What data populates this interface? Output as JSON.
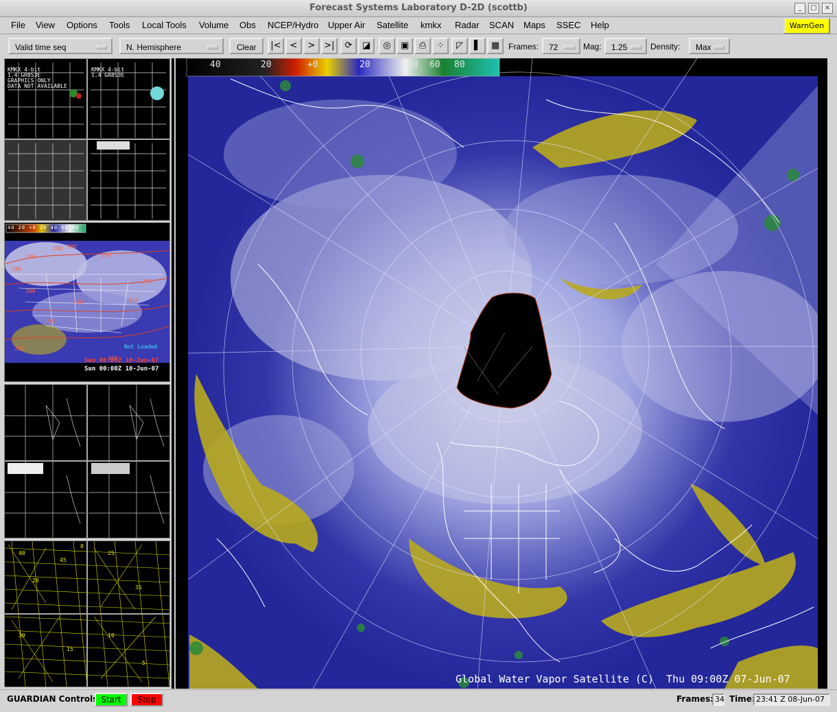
{
  "window": {
    "title": "Forecast Systems Laboratory D-2D (scottb)",
    "buttons": [
      "_",
      "□",
      "×"
    ]
  },
  "menu": {
    "items": [
      "File",
      "View",
      "Options",
      "Tools",
      "Local Tools",
      "Volume",
      "Obs",
      "NCEP/Hydro",
      "Upper Air",
      "Satellite",
      "kmkx",
      "Radar",
      "SCAN",
      "Maps",
      "SSEC",
      "Help"
    ],
    "warngen": "WarnGen"
  },
  "toolbar": {
    "time_mode": "Valid time seq",
    "projection": "N. Hemisphere",
    "clear": "Clear",
    "frames_label": "Frames:",
    "frames_value": "72",
    "mag_label": "Mag:",
    "mag_value": "1.25",
    "density_label": "Density:",
    "density_value": "Max"
  },
  "colorbar": {
    "labels": [
      "40",
      "20",
      "+0",
      "20",
      "40",
      "60",
      "80"
    ]
  },
  "left_panel": {
    "pane1": {
      "lines": [
        "KMKX 4-bit",
        "1.4 GR8S3E",
        "GRAPHICS ONLY",
        "DATA NOT AVAILABLE"
      ],
      "sub": [
        "KMKX 4-bit",
        "1.4 GR8S3E"
      ]
    },
    "pane2": {
      "scale": [
        "40",
        "20",
        "+0",
        "20",
        "40",
        "60",
        "80"
      ],
      "valid1": "Sun 00:00Z 10-Jun-07",
      "valid2": "Sun 00:00Z 10-Jun-07",
      "note": "Not Loaded",
      "contours": [
        "300",
        "290",
        "280",
        "270",
        "280",
        "290",
        "300",
        "290",
        "280",
        "270",
        "290",
        "300"
      ]
    },
    "pane4": {
      "nums": [
        "40",
        "45",
        "20",
        "25",
        "35",
        "30",
        "15",
        "10",
        "5",
        "0"
      ]
    }
  },
  "main": {
    "caption": "Global Water Vapor Satellite (C)",
    "valid_time": "Thu 09:00Z 07-Jun-07"
  },
  "status": {
    "guardian_label": "GUARDIAN Controls:",
    "start": "Start",
    "stop": "Stop",
    "frames_label": "Frames:",
    "frames_value": "34",
    "time_label": "Time:",
    "time_value": "23:41 Z 08-Jun-07"
  },
  "colors": {
    "start": "#00ff00",
    "stop": "#ff0000",
    "warngen": "#ffff00",
    "satellite_blue": "#23279a",
    "satellite_yellow": "#b8aa1e"
  }
}
